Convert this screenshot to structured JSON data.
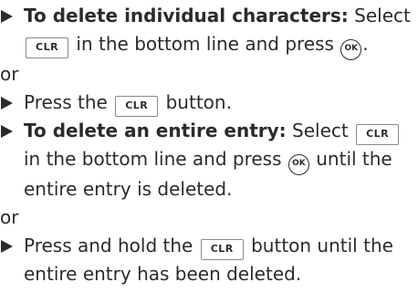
{
  "steps": [
    {
      "bold": "To delete individual characters:",
      "t1": " Select ",
      "key": "CLR",
      "t2": " in the bottom line and press ",
      "ok": "OK",
      "t3": "."
    },
    {
      "t1": "Press the ",
      "key": "CLR",
      "t2": " button."
    },
    {
      "bold": "To delete an entire entry:",
      "t1": " Select ",
      "key": "CLR",
      "t2": " in the bottom line and press ",
      "ok": "OK",
      "t3": " until the entire entry is deleted."
    },
    {
      "t1": "Press and hold the ",
      "key": "CLR",
      "t2": " button until the entire entry has been deleted."
    }
  ],
  "or_label": "or",
  "or_label_2": "or"
}
